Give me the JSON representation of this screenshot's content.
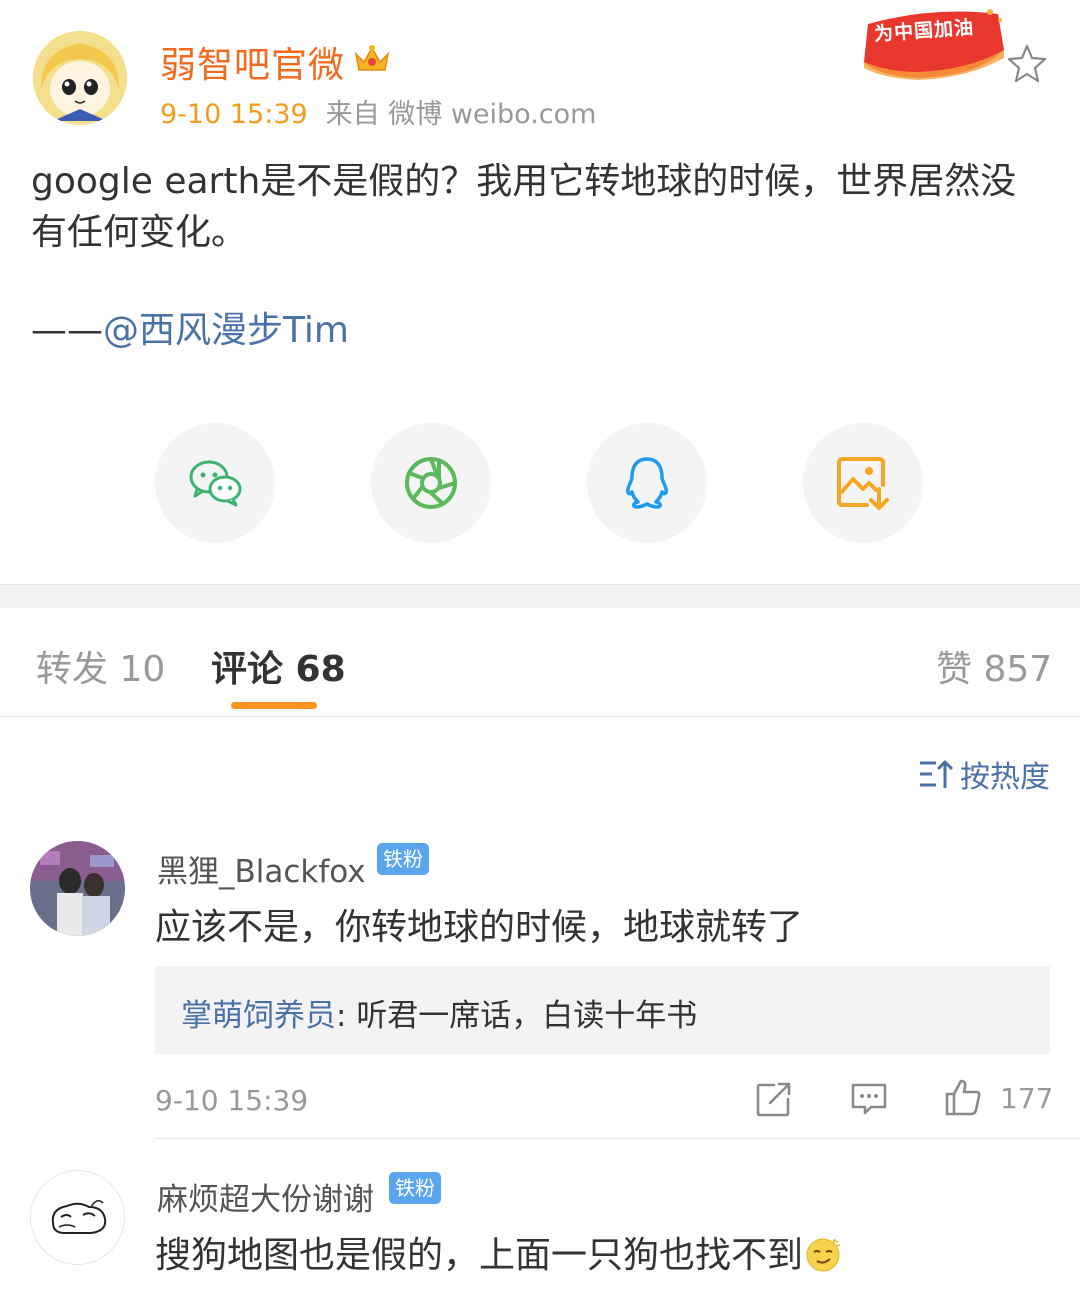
{
  "post": {
    "author": "弱智吧官微",
    "time": "9-10 15:39",
    "source": "来自 微博 weibo.com",
    "promo_badge": "为中国加油",
    "text": "google earth是不是假的？我用它转地球的时候，世界居然没有任何变化。",
    "quote_prefix": "——",
    "quote_mention": "@西风漫步Tim"
  },
  "share": {
    "items": [
      "wechat-icon",
      "moments-icon",
      "qq-icon",
      "save-image-icon"
    ]
  },
  "tabs": {
    "repost": "转发 10",
    "comments": "评论 68",
    "likes": "赞 857"
  },
  "sort": {
    "label": "按热度"
  },
  "comments": [
    {
      "user": "黑狸_Blackfox",
      "badge": "铁粉",
      "text": "应该不是，你转地球的时候，地球就转了",
      "reply_author": "掌萌饲养员",
      "reply_sep": ": ",
      "reply_text": "听君一席话，白读十年书",
      "time": "9-10 15:39",
      "likes": "177"
    },
    {
      "user": "麻烦超大份谢谢",
      "badge": "铁粉",
      "text": "搜狗地图也是假的，上面一只狗也找不到"
    }
  ],
  "colors": {
    "accent_orange": "#f36a1e",
    "link_blue": "#4a72a8",
    "badge_blue": "#5aa6ee",
    "tab_underline": "#f7941e"
  }
}
